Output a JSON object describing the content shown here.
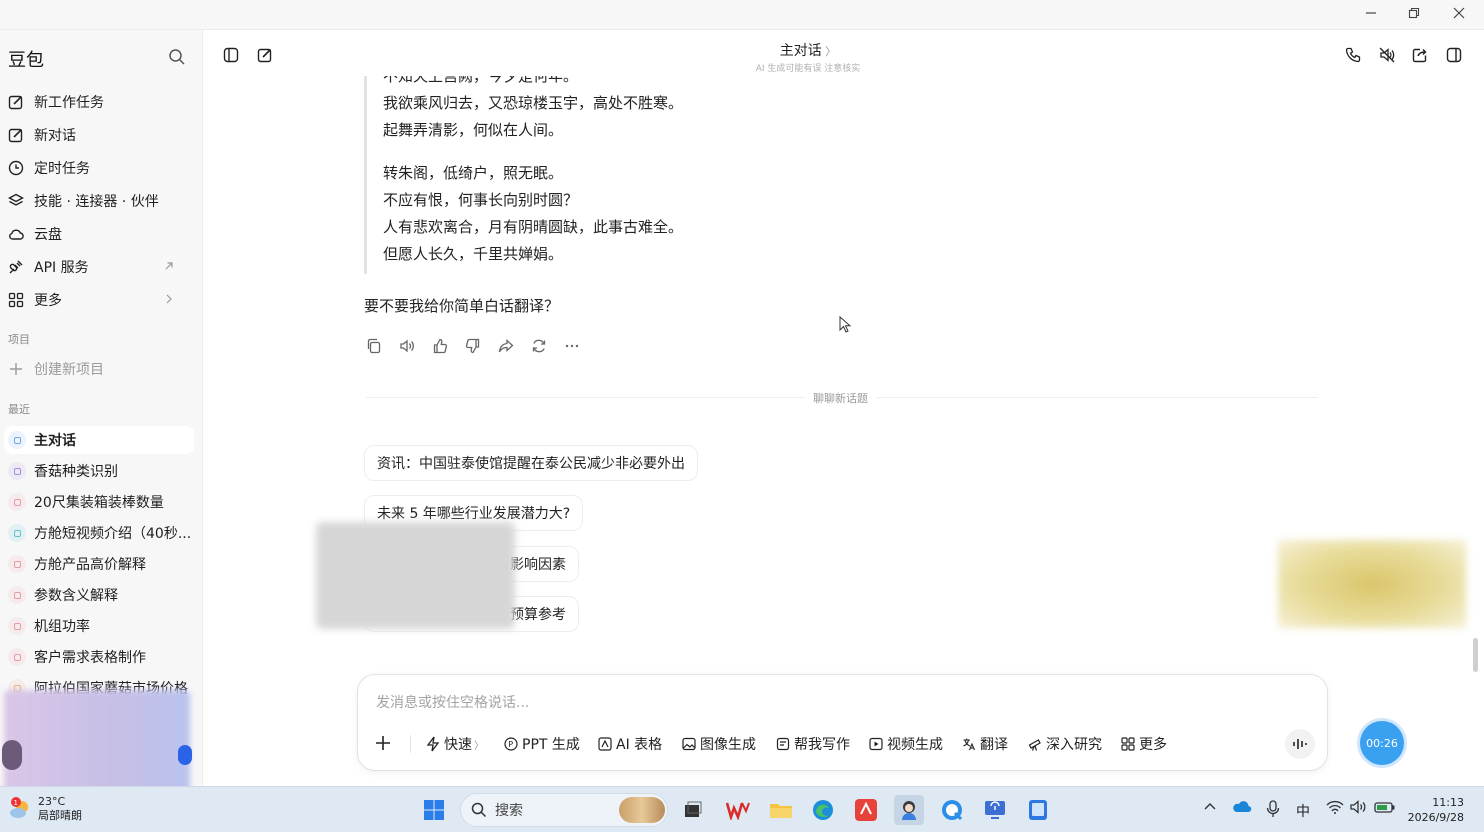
{
  "window": {
    "controls": [
      "minimize-icon",
      "restore-icon",
      "close-icon"
    ]
  },
  "sidebar": {
    "brand": "豆包",
    "nav": [
      {
        "label": "新工作任务",
        "icon": "edit-icon"
      },
      {
        "label": "新对话",
        "icon": "edit-icon"
      },
      {
        "label": "定时任务",
        "icon": "clock-icon"
      },
      {
        "label": "技能 · 连接器 · 伙伴",
        "icon": "layers-icon"
      },
      {
        "label": "云盘",
        "icon": "cloud-icon"
      },
      {
        "label": "API 服务",
        "icon": "api-icon"
      },
      {
        "label": "更多",
        "icon": "grid-icon"
      }
    ],
    "projects_label": "项目",
    "create_project": "创建新项目",
    "recent_label": "最近",
    "recent": [
      {
        "label": "主对话",
        "active": true,
        "color": "#6ea8e8"
      },
      {
        "label": "香菇种类识别",
        "color": "#a88ee0"
      },
      {
        "label": "20尺集装箱装棒数量",
        "color": "#e89aa8"
      },
      {
        "label": "方舱短视频介绍（40秒...",
        "color": "#5ec4d4"
      },
      {
        "label": "方舱产品高价解释",
        "color": "#e89aa8"
      },
      {
        "label": "参数含义解释",
        "color": "#e89aa8"
      },
      {
        "label": "机组功率",
        "color": "#e89aa8"
      },
      {
        "label": "客户需求表格制作",
        "color": "#e89aa8"
      },
      {
        "label": "阿拉伯国家蘑菇市场价格",
        "color": "#e8b07a"
      }
    ]
  },
  "header": {
    "title": "主对话",
    "subtitle": "AI 生成可能有误 注意核实"
  },
  "chat": {
    "poem_stanza1": [
      "不知天上宫阙，今夕是何年。",
      "我欲乘风归去，又恐琼楼玉宇，高处不胜寒。",
      "起舞弄清影，何似在人间。"
    ],
    "poem_stanza2": [
      "转朱阁，低绮户，照无眠。",
      "不应有恨，何事长向别时圆？",
      "人有悲欢离合，月有阴晴圆缺，此事古难全。",
      "但愿人长久，千里共婵娟。"
    ],
    "followup": "要不要我给你简单白话翻译？",
    "divider": "聊聊新话题",
    "suggestions": [
      "资讯：中国驻泰使馆提醒在泰公民减少非必要外出",
      "未来 5 年哪些行业发展潜力大?",
      "影响因素",
      "预算参考"
    ]
  },
  "composer": {
    "placeholder": "发消息或按住空格说话...",
    "mode": "快速",
    "tools": [
      "PPT 生成",
      "AI 表格",
      "图像生成",
      "帮我写作",
      "视频生成",
      "翻译",
      "深入研究",
      "更多"
    ]
  },
  "timer": "00:26",
  "taskbar": {
    "weather_temp": "23°C",
    "weather_desc": "局部晴朗",
    "weather_badge": "1",
    "search_label": "搜索",
    "ime": "中",
    "time": "11:13",
    "date": "2026/9/28"
  },
  "colors": {
    "accent": "#2a62e8",
    "timer": "#3aa0f0",
    "sidebar_bg": "#f7f7f8",
    "taskbar_bg": "#dfe9f4"
  }
}
